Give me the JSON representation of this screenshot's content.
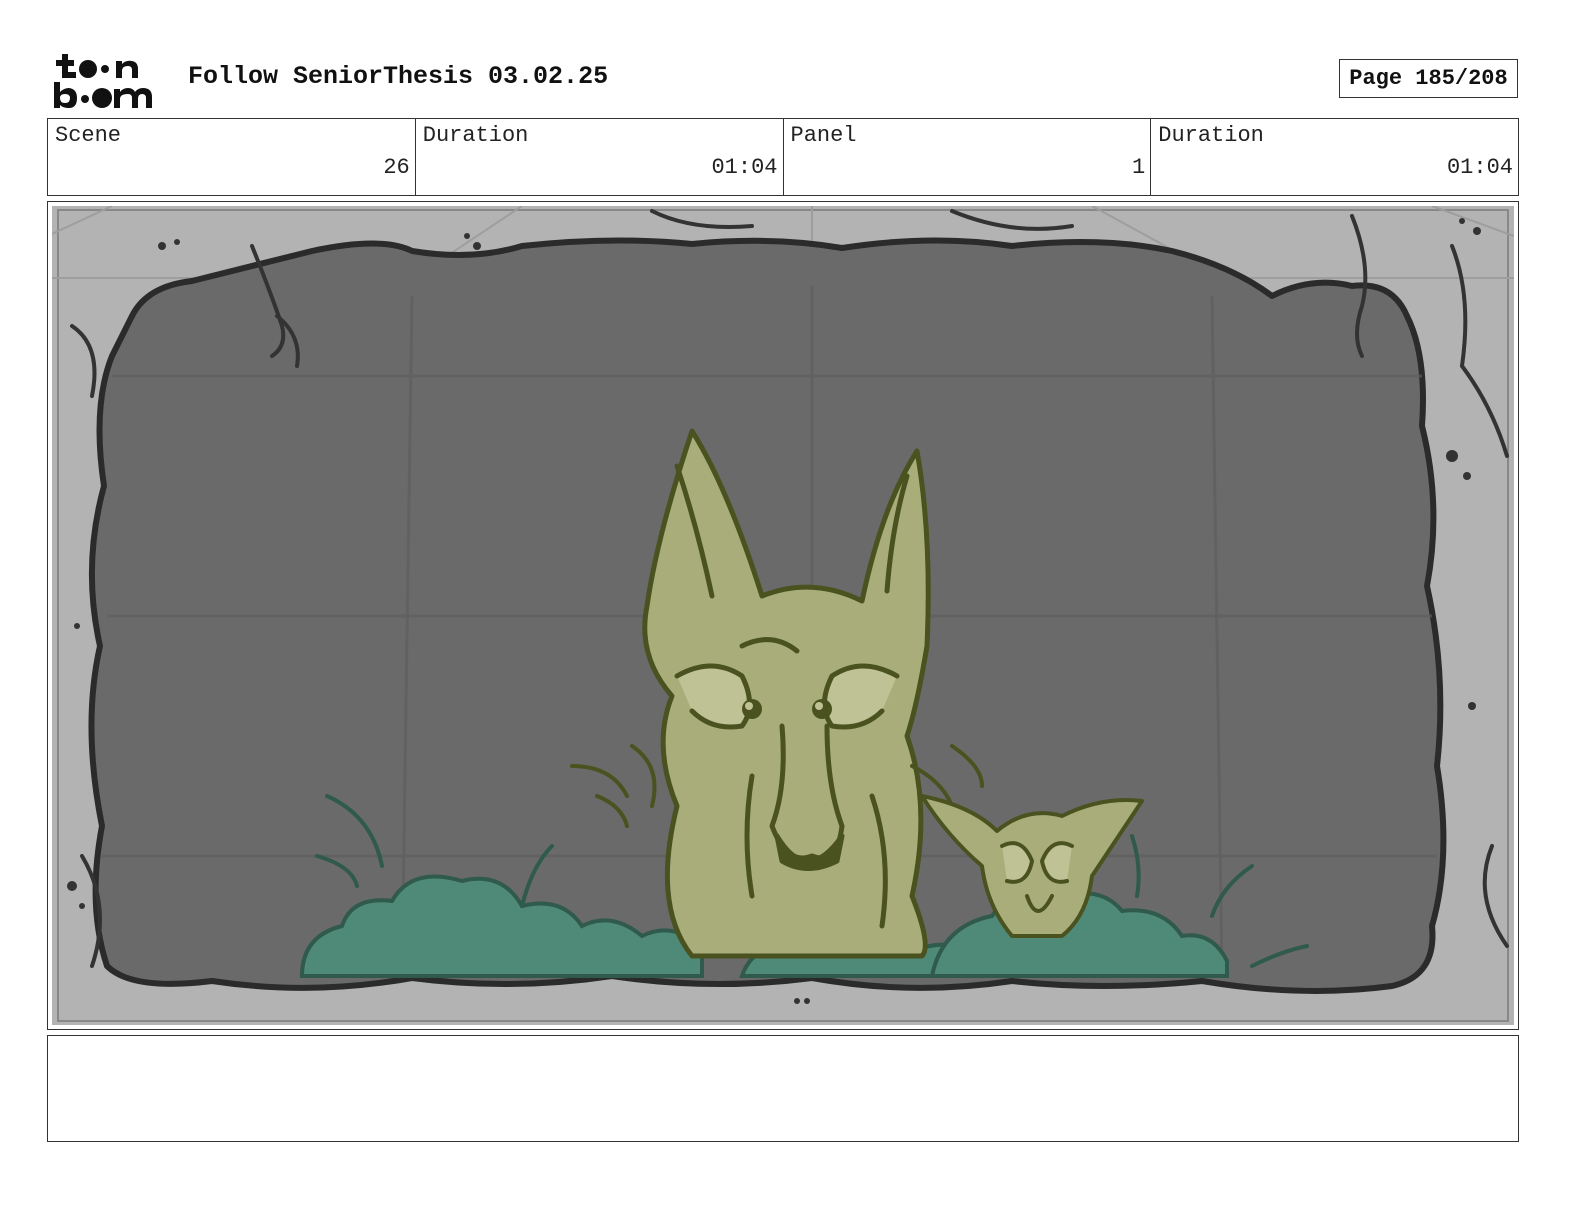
{
  "header": {
    "logo_text": "toon boom",
    "title": "Follow SeniorThesis 03.02.25",
    "page": "Page 185/208"
  },
  "info": {
    "scene_label": "Scene",
    "scene_value": "26",
    "duration_label": "Duration",
    "duration_value": "01:04",
    "panel_label": "Panel",
    "panel_value": "1",
    "panel_duration_label": "Duration",
    "panel_duration_value": "01:04"
  },
  "panel_image": {
    "icons": [
      "toon-boom-logo",
      "storyboard-drawing"
    ],
    "colors": {
      "cave_wall": "#b3b3b3",
      "cave_dark": "#6a6a6a",
      "fox_fill": "#a8ad7a",
      "fox_line": "#4a5220",
      "bush": "#4f8a78"
    }
  },
  "notes": {
    "text": ""
  }
}
